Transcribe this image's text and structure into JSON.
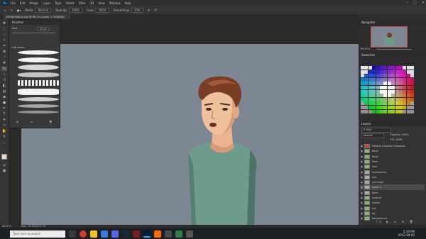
{
  "app": {
    "logo": "Ps"
  },
  "menu": {
    "items": [
      "File",
      "Edit",
      "Image",
      "Layer",
      "Type",
      "Select",
      "Filter",
      "3D",
      "View",
      "Window",
      "Help"
    ]
  },
  "window_controls": [
    "–",
    "□",
    "✕"
  ],
  "options_bar": {
    "mode_label": "Mode:",
    "mode_value": "Normal",
    "opacity_label": "Opacity:",
    "opacity_value": "100%",
    "flow_label": "Flow:",
    "flow_value": "100%",
    "smoothing_label": "Smoothing:",
    "smoothing_value": "10%",
    "angle_value": "0°"
  },
  "document": {
    "tab_title": "CHAIN MAN 4.psd @ 66.7% (Layer 1, RGB/8#)"
  },
  "brush_panel": {
    "title": "Brushes",
    "size_label": "Size:",
    "size_value": "20 px",
    "group_label": "Brushes"
  },
  "navigator": {
    "title": "Navigator",
    "zoom": "66.67%"
  },
  "swatches": {
    "title": "Swatches"
  },
  "layers": {
    "title": "Layers",
    "kind_label": "Kind",
    "blend_mode": "Normal",
    "opacity_label": "Opacity:",
    "opacity_value": "100%",
    "fill_label": "Fill:",
    "fill_value": "100%",
    "rows": [
      {
        "name": "Default (Liquefy) Snapshot",
        "color": "#c94040"
      },
      {
        "name": "Body",
        "color": "#8ab37a"
      },
      {
        "name": "Body",
        "color": "#8ab37a"
      },
      {
        "name": "Face",
        "color": "#8ab37a"
      },
      {
        "name": "Hair",
        "color": "#8ab37a"
      },
      {
        "name": "Accessories",
        "color": "#aaa"
      },
      {
        "name": "eye",
        "color": "#aaa"
      },
      {
        "name": "eye brow",
        "color": "#aaa"
      },
      {
        "name": "Layer 1",
        "color": "#aaa"
      },
      {
        "name": "base",
        "color": "#aaa"
      },
      {
        "name": "colored",
        "color": "#8ab37a"
      },
      {
        "name": "sketch",
        "color": "#8ab37a"
      },
      {
        "name": "old",
        "color": "#8ab37a"
      },
      {
        "name": "bg",
        "color": "#8ab37a"
      },
      {
        "name": "Background",
        "color": "#8ab37a"
      }
    ]
  },
  "status_bar": {
    "zoom": "66.67%",
    "doc_info": "Doc: 18.0M/216.7M"
  },
  "taskbar": {
    "search_placeholder": "Type here to search",
    "time": "2:19 PM",
    "date": "2022-09-05"
  }
}
